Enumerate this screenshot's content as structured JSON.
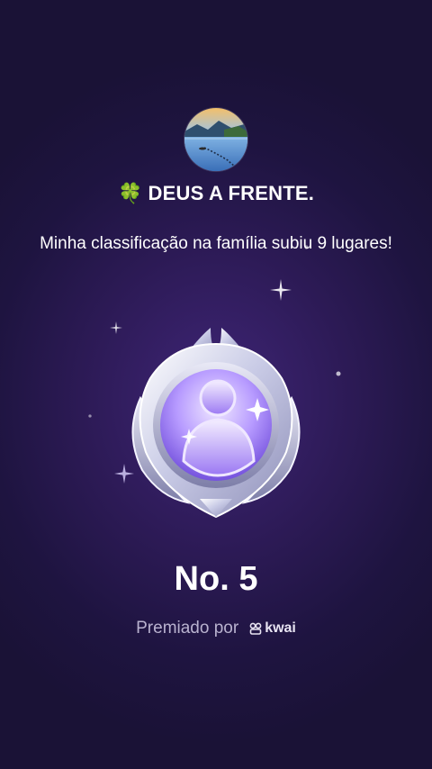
{
  "header": {
    "emoji": "🍀",
    "title": "DEUS A FRENTE."
  },
  "message": "Minha classificação na família subiu 9 lugares!",
  "rank": "No. 5",
  "footer": {
    "awarded_by": "Premiado por",
    "brand": "kwai"
  },
  "icons": {
    "avatar": "user-avatar-lake-photo",
    "medal": "rank-medal-icon",
    "brand": "kwai-logo-icon"
  },
  "colors": {
    "background": "#2a1a50",
    "clover": "#3fbf3a",
    "muted_text": "#b9b2cf"
  }
}
